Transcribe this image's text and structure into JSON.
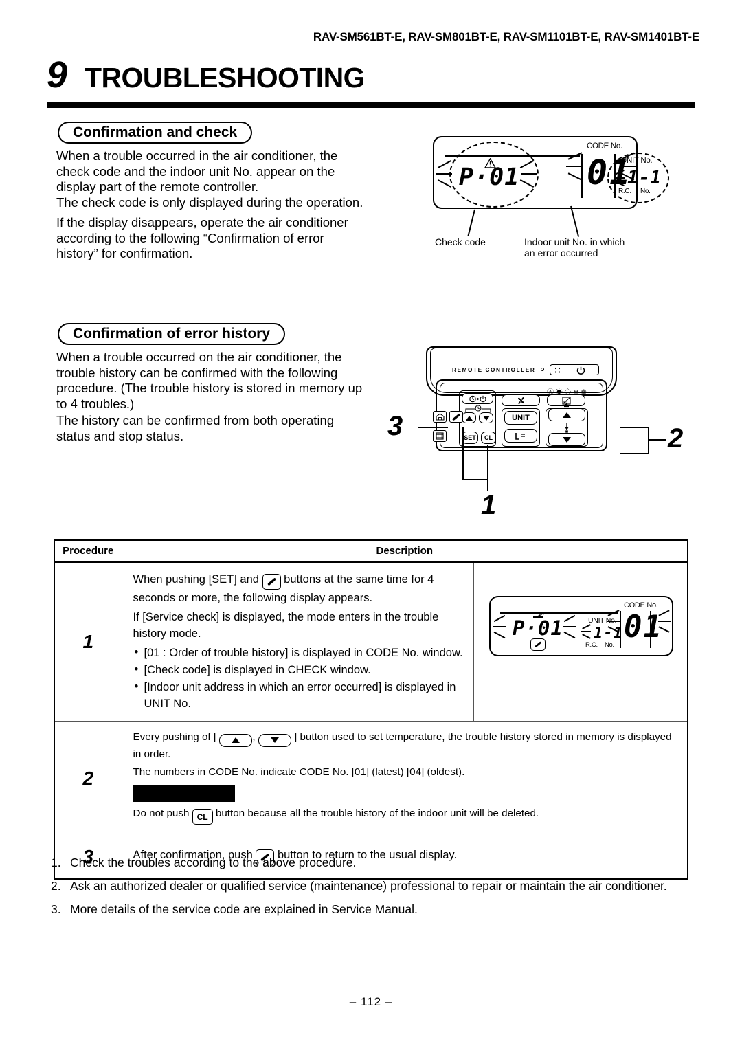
{
  "header": {
    "models": "RAV-SM561BT-E, RAV-SM801BT-E, RAV-SM1101BT-E, RAV-SM1401BT-E",
    "chapter_number": "9",
    "chapter_title": "TROUBLESHOOTING"
  },
  "section1": {
    "heading": "Confirmation and check",
    "paragraphs": [
      "When a trouble occurred in the air conditioner, the check code and the indoor unit No. appear on the display part of the remote controller.",
      "The check code is only displayed during the operation.",
      "If the display disappears, operate the air conditioner according to the following “Confirmation of error history” for confirmation."
    ],
    "lcd": {
      "check_code": "P·01",
      "unit_no_label": "UNIT No.",
      "unit_no_value": "1-1",
      "rc_label": "R.C.",
      "rc_no_label": "No.",
      "code_no_label": "CODE No.",
      "code_no_value": "01"
    },
    "captions": {
      "left": "Check code",
      "right_line1": "Indoor unit No. in which",
      "right_line2": "an error occurred"
    }
  },
  "section2": {
    "heading": "Confirmation of error history",
    "paragraphs": [
      "When a trouble occurred on the air conditioner, the trouble history can be confirmed with the following procedure. (The trouble history is stored in memory up to 4 troubles.)",
      "The history can be confirmed from both operating status and stop status."
    ],
    "remote": {
      "title": "REMOTE CONTROLLER",
      "power_icon": "power-icon",
      "buttons": {
        "unit": "UNIT",
        "set": "SET",
        "cl": "CL",
        "timer": "timer-onoff-icon",
        "fan": "fan-icon",
        "louver": "louver-icon",
        "wrench": "wrench-icon",
        "home": "home-icon",
        "grid": "grid-icon",
        "swing": "swing-icon",
        "up": "arrow-up-icon",
        "down": "arrow-down-icon",
        "temp_up": "temp-up-icon",
        "temp_down": "temp-down-icon"
      },
      "mode_icons": "Ⓐ ☀ ◇ ❄ ❁"
    },
    "callouts": {
      "one": "1",
      "two": "2",
      "three": "3"
    }
  },
  "table": {
    "headers": {
      "procedure": "Procedure",
      "description": "Description"
    },
    "rows": [
      {
        "step": "1",
        "line1_a": "When pushing [SET] and",
        "line1_b": "buttons at the same time for 4 seconds or more, the following display appears.",
        "line2": "If [Service check] is displayed, the mode enters in the trouble history mode.",
        "bullets": [
          "[01 : Order of trouble history] is displayed in CODE No. window.",
          "[Check code] is displayed in CHECK window.",
          "[Indoor unit address in which an error occurred] is displayed in UNIT No."
        ],
        "lcd": {
          "check_code": "P·01",
          "unit_no_label": "UNIT No.",
          "unit_no_value": "1-1",
          "rc_label": "R.C.",
          "rc_no_label": "No.",
          "code_no_label": "CODE No.",
          "code_no_value": "01"
        }
      },
      {
        "step": "2",
        "line1_a": "Every pushing of [",
        "line1_b": ",",
        "line1_c": "] button used to set temperature, the trouble history stored in memory is displayed in order.",
        "line2": "The numbers in CODE No. indicate CODE No.  [01] (latest)      [04] (oldest).",
        "line3_a": "Do not push",
        "line3_b": "button because all the trouble history of the indoor unit will be deleted.",
        "cl_label": "CL"
      },
      {
        "step": "3",
        "line_a": "After confirmation, push",
        "line_b": "button to return to the usual display."
      }
    ]
  },
  "notes": [
    {
      "index": "1.",
      "text": "Check the troubles according to the above procedure."
    },
    {
      "index": "2.",
      "text": "Ask an authorized dealer or qualified service (maintenance) professional to repair or maintain the air conditioner."
    },
    {
      "index": "3.",
      "text": "More details of the service code are explained in Service Manual."
    }
  ],
  "footer": {
    "page": "– 112 –"
  }
}
